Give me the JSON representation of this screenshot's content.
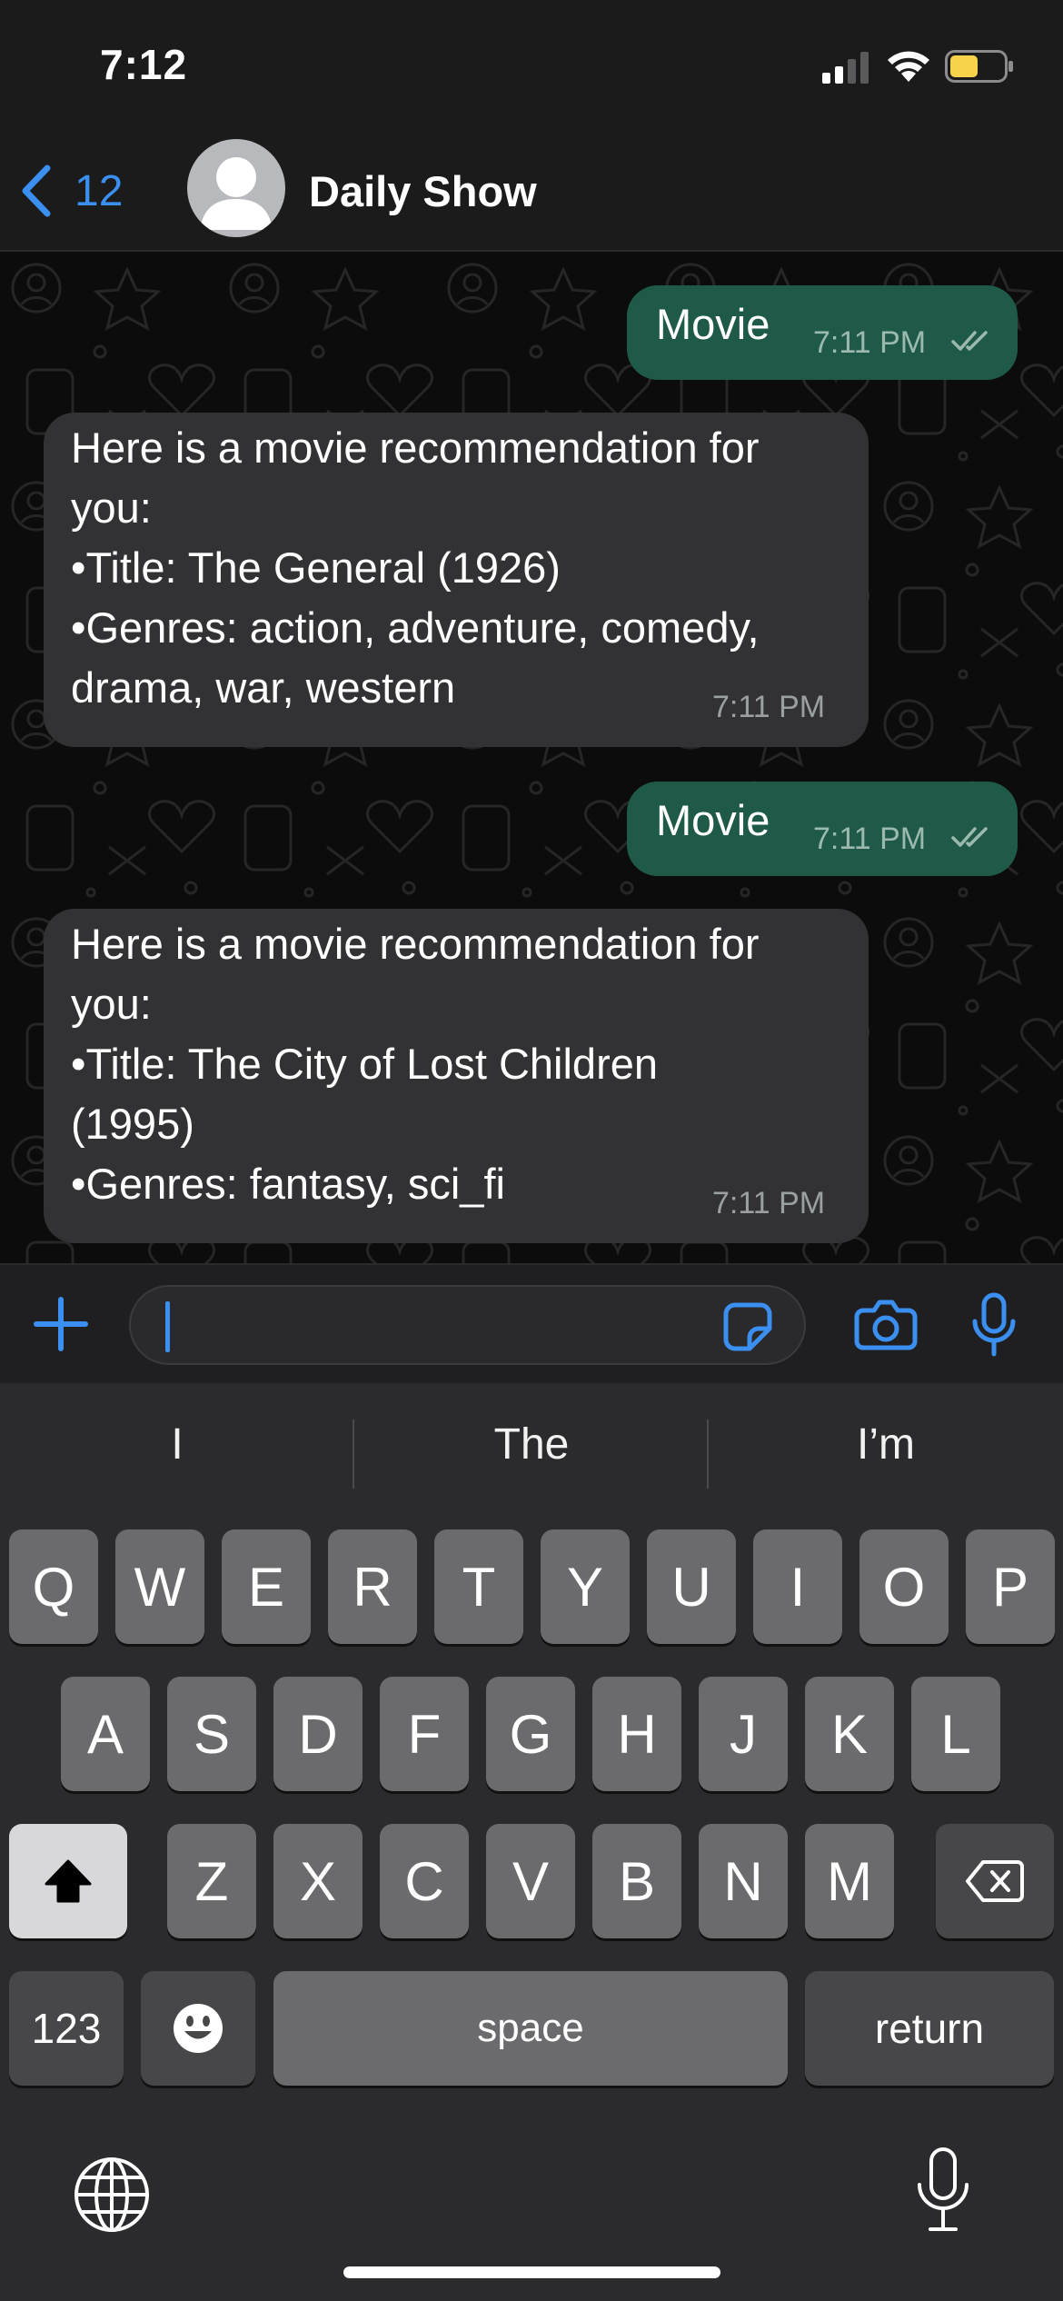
{
  "status_bar": {
    "time": "7:12",
    "icons": [
      "signal-icon",
      "wifi-icon",
      "battery-icon"
    ]
  },
  "header": {
    "back_count": "12",
    "title": "Daily Show",
    "icons": [
      "chevron-left-icon",
      "avatar-placeholder-icon"
    ]
  },
  "colors": {
    "accent": "#3b8ff0",
    "outgoing_bubble": "#1f5a49",
    "incoming_bubble": "#323234",
    "battery_fill": "#f6d34a"
  },
  "messages": [
    {
      "direction": "outgoing",
      "text": "Movie",
      "time": "7:11 PM",
      "status": "read-ticks-icon"
    },
    {
      "direction": "incoming",
      "text": "Here is a movie recommendation for you:\n•Title: The General (1926)\n•Genres: action, adventure, comedy, drama, war, western",
      "time": "7:11 PM"
    },
    {
      "direction": "outgoing",
      "text": "Movie",
      "time": "7:11 PM",
      "status": "read-ticks-icon"
    },
    {
      "direction": "incoming",
      "text": "Here is a movie recommendation for you:\n•Title: The City of Lost Children (1995)\n•Genres: fantasy, sci_fi",
      "time": "7:11 PM"
    }
  ],
  "input_bar": {
    "value": "",
    "icons": [
      "plus-icon",
      "sticker-icon",
      "camera-icon",
      "microphone-icon"
    ]
  },
  "keyboard": {
    "suggestions": [
      "I",
      "The",
      "I’m"
    ],
    "row1": [
      "Q",
      "W",
      "E",
      "R",
      "T",
      "Y",
      "U",
      "I",
      "O",
      "P"
    ],
    "row2": [
      "A",
      "S",
      "D",
      "F",
      "G",
      "H",
      "J",
      "K",
      "L"
    ],
    "row3": [
      "Z",
      "X",
      "C",
      "V",
      "B",
      "N",
      "M"
    ],
    "numbers_label": "123",
    "space_label": "space",
    "return_label": "return",
    "icons": [
      "shift-icon",
      "backspace-icon",
      "emoji-icon",
      "globe-icon",
      "dictation-icon"
    ]
  }
}
